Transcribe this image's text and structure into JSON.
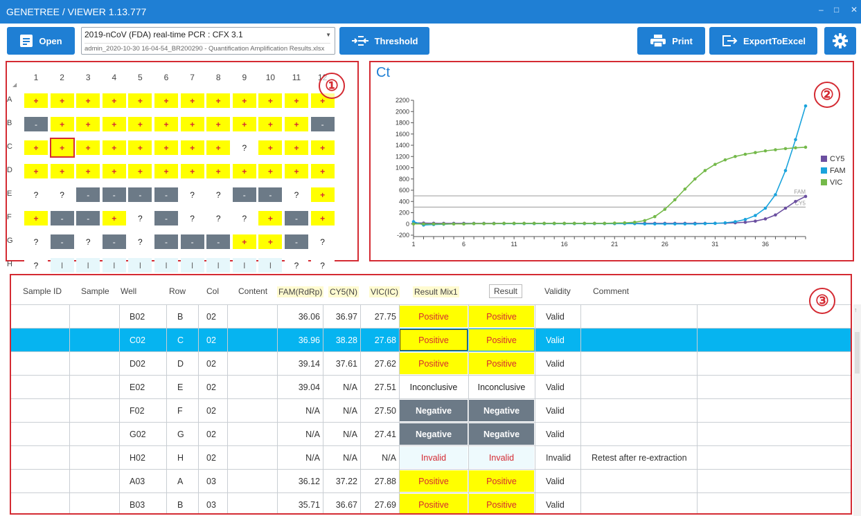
{
  "title": "GENETREE / VIEWER 1.13.777",
  "window_controls": [
    "–",
    "□",
    "✕"
  ],
  "toolbar": {
    "open_label": "Open",
    "combo_title": "2019-nCoV (FDA) real-time PCR : CFX 3.1",
    "combo_file": "admin_2020-10-30 16-04-54_BR200290 -  Quantification Amplification Results.xlsx",
    "threshold_label": "Threshold",
    "print_label": "Print",
    "export_label": "ExportToExcel"
  },
  "callouts": [
    "①",
    "②",
    "③"
  ],
  "plate": {
    "columns": [
      "1",
      "2",
      "3",
      "4",
      "5",
      "6",
      "7",
      "8",
      "9",
      "10",
      "11",
      "12"
    ],
    "rows": [
      {
        "label": "A",
        "cells": [
          "+",
          "+",
          "+",
          "+",
          "+",
          "+",
          "+",
          "+",
          "+",
          "+",
          "+",
          "+"
        ]
      },
      {
        "label": "B",
        "cells": [
          "-",
          "+",
          "+",
          "+",
          "+",
          "+",
          "+",
          "+",
          "+",
          "+",
          "+",
          "-"
        ]
      },
      {
        "label": "C",
        "cells": [
          "+",
          "+",
          "+",
          "+",
          "+",
          "+",
          "+",
          "+",
          "?",
          "+",
          "+",
          "+"
        ]
      },
      {
        "label": "D",
        "cells": [
          "+",
          "+",
          "+",
          "+",
          "+",
          "+",
          "+",
          "+",
          "+",
          "+",
          "+",
          "+"
        ]
      },
      {
        "label": "E",
        "cells": [
          "?",
          "?",
          "-",
          "-",
          "-",
          "-",
          "?",
          "?",
          "-",
          "-",
          "?",
          "+"
        ]
      },
      {
        "label": "F",
        "cells": [
          "+",
          "-",
          "-",
          "+",
          "?",
          "-",
          "?",
          "?",
          "?",
          "+",
          "-",
          "+"
        ]
      },
      {
        "label": "G",
        "cells": [
          "?",
          "-",
          "?",
          "-",
          "?",
          "-",
          "-",
          "-",
          "+",
          "+",
          "-",
          "?"
        ]
      },
      {
        "label": "H",
        "cells": [
          "?",
          "I",
          "I",
          "I",
          "I",
          "I",
          "I",
          "I",
          "I",
          "I",
          "?",
          "?"
        ]
      }
    ],
    "selected": {
      "row": "C",
      "col": "2"
    }
  },
  "chart_data": {
    "type": "line",
    "title": "Ct",
    "x": [
      1,
      2,
      3,
      4,
      5,
      6,
      7,
      8,
      9,
      10,
      11,
      12,
      13,
      14,
      15,
      16,
      17,
      18,
      19,
      20,
      21,
      22,
      23,
      24,
      25,
      26,
      27,
      28,
      29,
      30,
      31,
      32,
      33,
      34,
      35,
      36,
      37,
      38,
      39,
      40
    ],
    "xticks": [
      "1",
      "6",
      "11",
      "16",
      "21",
      "26",
      "31",
      "36"
    ],
    "yticks": [
      "-200",
      "0",
      "200",
      "400",
      "600",
      "800",
      "1000",
      "1200",
      "1400",
      "1600",
      "1800",
      "2000",
      "2200"
    ],
    "ylim": [
      -200,
      2200
    ],
    "legend_position": "right",
    "thresholds": [
      {
        "label": "FAM",
        "value": 500
      },
      {
        "label": "CY5",
        "value": 300
      }
    ],
    "series": [
      {
        "name": "CY5",
        "color": "#6b4fa0",
        "values": [
          20,
          15,
          12,
          10,
          10,
          10,
          10,
          10,
          10,
          10,
          10,
          10,
          10,
          10,
          10,
          10,
          10,
          10,
          10,
          10,
          10,
          10,
          10,
          10,
          10,
          10,
          10,
          10,
          10,
          10,
          12,
          15,
          20,
          30,
          50,
          90,
          160,
          280,
          400,
          490
        ]
      },
      {
        "name": "FAM",
        "color": "#1aa3dc",
        "values": [
          40,
          -20,
          -10,
          -5,
          0,
          0,
          5,
          5,
          5,
          5,
          5,
          5,
          5,
          5,
          5,
          5,
          5,
          5,
          5,
          5,
          5,
          5,
          5,
          0,
          0,
          0,
          0,
          0,
          0,
          5,
          10,
          20,
          40,
          80,
          150,
          280,
          520,
          950,
          1500,
          2100
        ]
      },
      {
        "name": "VIC",
        "color": "#74b94a",
        "values": [
          0,
          0,
          0,
          0,
          0,
          0,
          5,
          5,
          5,
          10,
          10,
          10,
          10,
          10,
          10,
          10,
          10,
          10,
          10,
          10,
          15,
          20,
          30,
          60,
          130,
          260,
          430,
          620,
          800,
          950,
          1060,
          1140,
          1200,
          1240,
          1270,
          1300,
          1320,
          1340,
          1355,
          1365
        ]
      }
    ]
  },
  "table": {
    "headers": [
      "Sample ID",
      "Sample",
      "Well",
      "Row",
      "Col",
      "Content",
      "FAM(RdRp)",
      "CY5(N)",
      "VIC(IC)",
      "Result Mix1",
      "Result",
      "Validity",
      "Comment"
    ],
    "rows": [
      {
        "sample_id": "",
        "sample": "",
        "well": "B02",
        "row": "B",
        "col": "02",
        "content": "",
        "fam": "36.06",
        "cy5": "36.97",
        "vic": "27.75",
        "mix1": "Positive",
        "result": "Positive",
        "validity": "Valid",
        "comment": ""
      },
      {
        "sample_id": "",
        "sample": "",
        "well": "C02",
        "row": "C",
        "col": "02",
        "content": "",
        "fam": "36.96",
        "cy5": "38.28",
        "vic": "27.68",
        "mix1": "Positive",
        "result": "Positive",
        "validity": "Valid",
        "comment": ""
      },
      {
        "sample_id": "",
        "sample": "",
        "well": "D02",
        "row": "D",
        "col": "02",
        "content": "",
        "fam": "39.14",
        "cy5": "37.61",
        "vic": "27.62",
        "mix1": "Positive",
        "result": "Positive",
        "validity": "Valid",
        "comment": ""
      },
      {
        "sample_id": "",
        "sample": "",
        "well": "E02",
        "row": "E",
        "col": "02",
        "content": "",
        "fam": "39.04",
        "cy5": "N/A",
        "vic": "27.51",
        "mix1": "Inconclusive",
        "result": "Inconclusive",
        "validity": "Valid",
        "comment": ""
      },
      {
        "sample_id": "",
        "sample": "",
        "well": "F02",
        "row": "F",
        "col": "02",
        "content": "",
        "fam": "N/A",
        "cy5": "N/A",
        "vic": "27.50",
        "mix1": "Negative",
        "result": "Negative",
        "validity": "Valid",
        "comment": ""
      },
      {
        "sample_id": "",
        "sample": "",
        "well": "G02",
        "row": "G",
        "col": "02",
        "content": "",
        "fam": "N/A",
        "cy5": "N/A",
        "vic": "27.41",
        "mix1": "Negative",
        "result": "Negative",
        "validity": "Valid",
        "comment": ""
      },
      {
        "sample_id": "",
        "sample": "",
        "well": "H02",
        "row": "H",
        "col": "02",
        "content": "",
        "fam": "N/A",
        "cy5": "N/A",
        "vic": "N/A",
        "mix1": "Invalid",
        "result": "Invalid",
        "validity": "Invalid",
        "comment": "Retest after re-extraction"
      },
      {
        "sample_id": "",
        "sample": "",
        "well": "A03",
        "row": "A",
        "col": "03",
        "content": "",
        "fam": "36.12",
        "cy5": "37.22",
        "vic": "27.88",
        "mix1": "Positive",
        "result": "Positive",
        "validity": "Valid",
        "comment": ""
      },
      {
        "sample_id": "",
        "sample": "",
        "well": "B03",
        "row": "B",
        "col": "03",
        "content": "",
        "fam": "35.71",
        "cy5": "36.67",
        "vic": "27.69",
        "mix1": "Positive",
        "result": "Positive",
        "validity": "Valid",
        "comment": ""
      }
    ],
    "selected_index": 1
  },
  "colors": {
    "brand": "#1f7fd4",
    "positive": "#ffff00",
    "negative": "#6c7a87",
    "selection": "#06b4f0",
    "callout": "#d42a32"
  }
}
